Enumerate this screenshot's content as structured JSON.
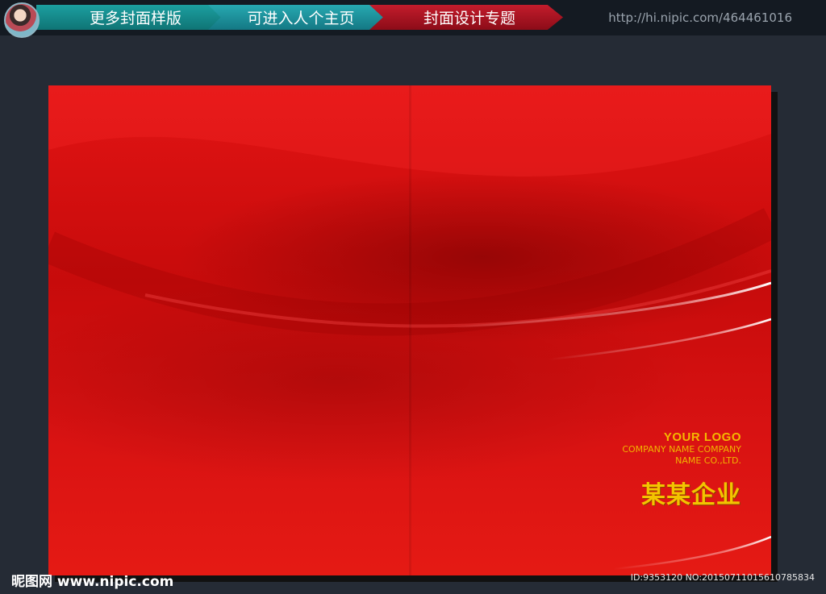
{
  "nav": {
    "item1": "更多封面样版",
    "item2": "可进入人个主页",
    "item3": "封面设计专题",
    "url": "http://hi.nipic.com/464461016"
  },
  "cover": {
    "logo": "YOUR LOGO",
    "company_line1": "COMPANY NAME COMPANY",
    "company_line2": "NAME CO.,LTD.",
    "company_cn": "某某企业"
  },
  "footer": {
    "watermark": "昵图网 www.nipic.com",
    "id_info": "ID:9353120 NO:20150711015610785834"
  },
  "colors": {
    "background": "#252b35",
    "cover_red": "#d81212",
    "gold": "#f5b800"
  }
}
